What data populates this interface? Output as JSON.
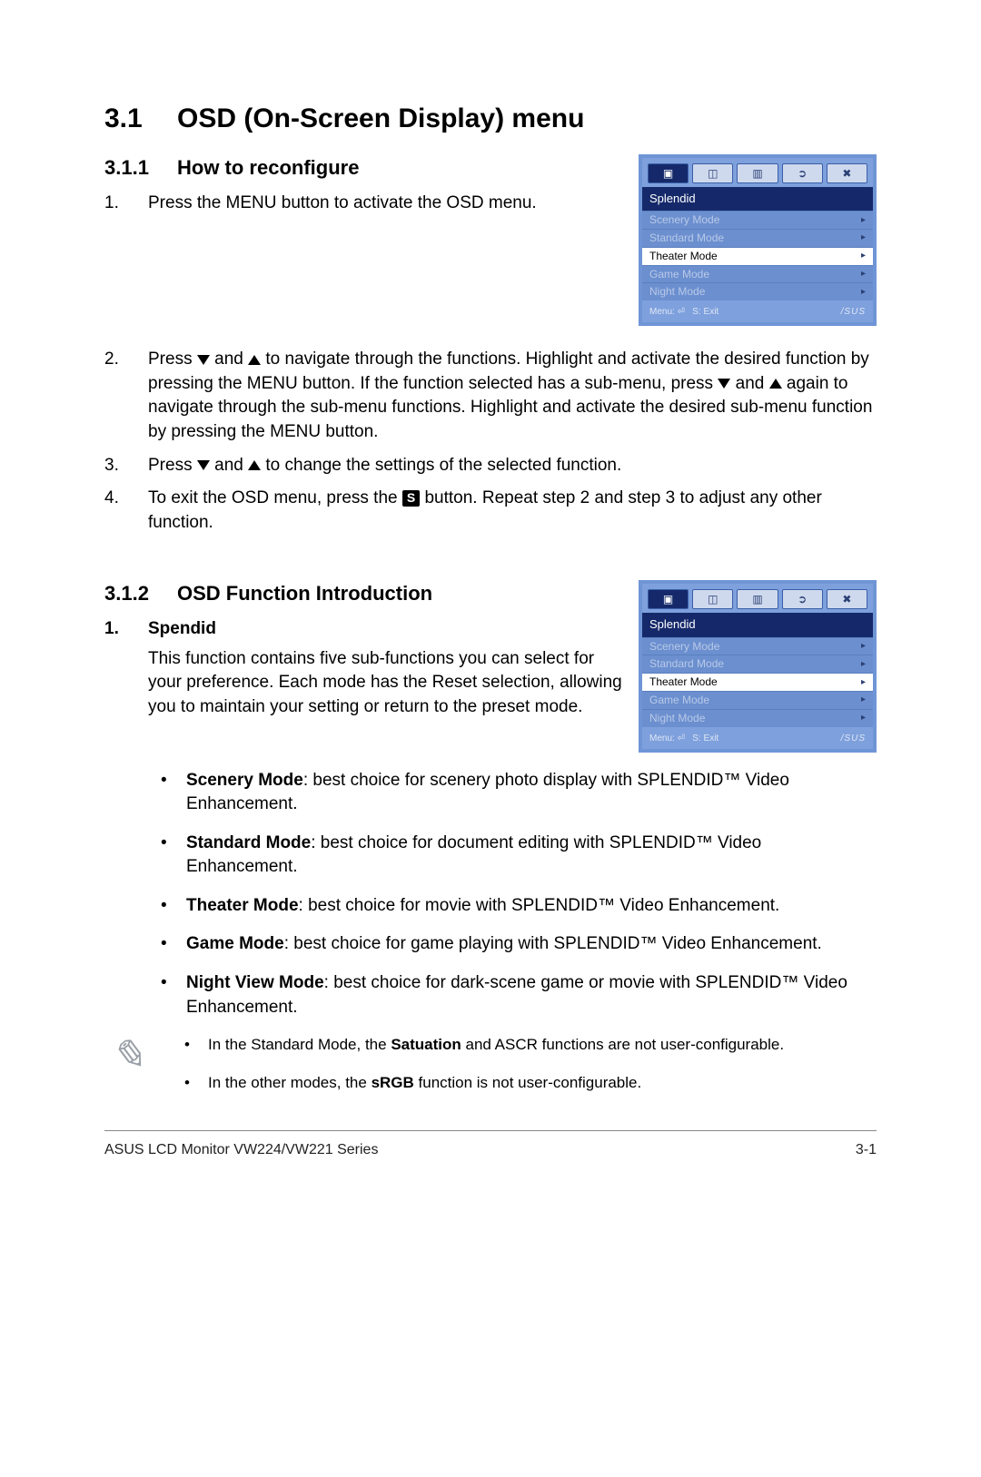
{
  "headings": {
    "h1_num": "3.1",
    "h1_text": "OSD (On-Screen Display) menu",
    "h2a_num": "3.1.1",
    "h2a_text": "How to reconfigure",
    "h2b_num": "3.1.2",
    "h2b_text": "OSD Function Introduction"
  },
  "steps": {
    "s1_n": "1.",
    "s1_a": "Press the MENU button to activate the OSD menu.",
    "s2_n": "2.",
    "s2_a": "Press ",
    "s2_b": " and ",
    "s2_c": " to navigate through the functions. Highlight and activate the desired function by pressing the MENU button. If the function selected has a sub-menu, press ",
    "s2_d": " and ",
    "s2_e": " again to navigate through the sub-menu functions. Highlight and activate the desired sub-menu function by pressing the MENU button.",
    "s3_n": "3.",
    "s3_a": "Press ",
    "s3_b": " and ",
    "s3_c": " to change the settings of the selected function.",
    "s4_n": "4.",
    "s4_a": "To exit the OSD menu, press the ",
    "s4_btn": "S",
    "s4_b": " button. Repeat step 2 and step 3 to adjust any other function."
  },
  "splendid": {
    "head_n": "1.",
    "head_t": "Spendid",
    "intro": "This function contains five sub-functions you can select for your preference. Each mode has the Reset selection, allowing you to maintain your setting or return to the preset mode."
  },
  "bullets": {
    "b1_h": "Scenery Mode",
    "b1_t": ": best choice for scenery photo display with SPLENDID™ Video Enhancement.",
    "b2_h": "Standard Mode",
    "b2_t": ": best choice for document editing with SPLENDID™ Video Enhancement.",
    "b3_h": "Theater Mode",
    "b3_t": ": best choice for movie with SPLENDID™ Video Enhancement.",
    "b4_h": "Game Mode",
    "b4_t": ": best choice for game playing with SPLENDID™ Video Enhancement.",
    "b5_h": "Night View Mode",
    "b5_t": ": best choice for dark-scene game or movie with SPLENDID™ Video Enhancement."
  },
  "notes": {
    "n1_a": "In the Standard Mode, the ",
    "n1_b": "Satuation",
    "n1_c": " and ASCR functions are not user-configurable.",
    "n2_a": "In the other modes, the ",
    "n2_b": "sRGB",
    "n2_c": " function is not user-configurable."
  },
  "osd": {
    "title": "Splendid",
    "items": [
      "Scenery Mode",
      "Standard Mode",
      "Theater Mode",
      "Game Mode",
      "Night Mode"
    ],
    "selected_index": 2,
    "foot_menu": "Menu:",
    "foot_exit": "S: Exit",
    "brand": "/SUS"
  },
  "footer": {
    "left": "ASUS LCD Monitor VW224/VW221 Series",
    "right": "3-1"
  },
  "glyphs": {
    "dot": "•",
    "pen": "✎"
  }
}
